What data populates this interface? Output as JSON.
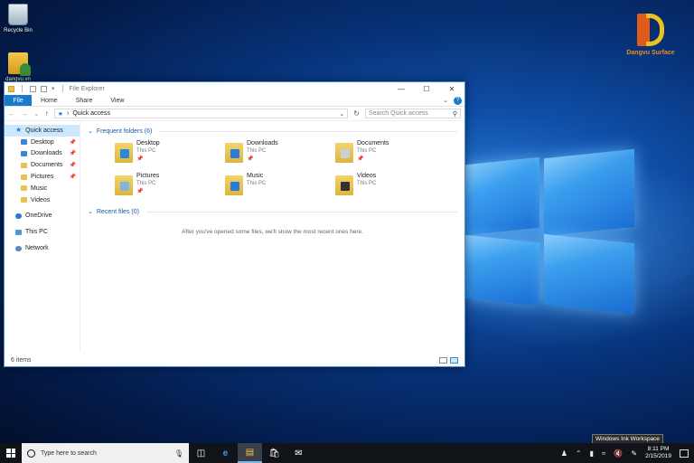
{
  "desktop": {
    "icons": [
      {
        "label": "Recycle Bin",
        "icon": "recycle-bin-icon"
      },
      {
        "label": "dangvu.vn",
        "icon": "user-folder-icon"
      }
    ],
    "brand": "Dangvu Surface"
  },
  "explorer": {
    "title": "File Explorer",
    "ribbon_tabs": [
      "File",
      "Home",
      "Share",
      "View"
    ],
    "address": "Quick access",
    "search_placeholder": "Search Quick access",
    "sidebar": {
      "quick_access": "Quick access",
      "pinned": [
        "Desktop",
        "Downloads",
        "Documents",
        "Pictures"
      ],
      "unpinned": [
        "Music",
        "Videos"
      ],
      "onedrive": "OneDrive",
      "this_pc": "This PC",
      "network": "Network"
    },
    "frequent_folders": {
      "header": "Frequent folders (6)",
      "items": [
        {
          "name": "Desktop",
          "location": "This PC",
          "pinned": true,
          "color": "#2a8ad8"
        },
        {
          "name": "Downloads",
          "location": "This PC",
          "pinned": true,
          "color": "#2a7bd8"
        },
        {
          "name": "Documents",
          "location": "This PC",
          "pinned": true,
          "color": "#c8d0d8"
        },
        {
          "name": "Pictures",
          "location": "This PC",
          "pinned": true,
          "color": "#7fb6e0"
        },
        {
          "name": "Music",
          "location": "This PC",
          "pinned": false,
          "color": "#2a7bd8"
        },
        {
          "name": "Videos",
          "location": "This PC",
          "pinned": false,
          "color": "#333333"
        }
      ]
    },
    "recent_files": {
      "header": "Recent files (0)",
      "empty_message": "After you've opened some files, we'll show the most recent ones here."
    },
    "status": "6 items"
  },
  "taskbar": {
    "search_placeholder": "Type here to search",
    "time": "8:11 PM",
    "date": "2/15/2019",
    "tooltip": "Windows Ink Workspace"
  }
}
